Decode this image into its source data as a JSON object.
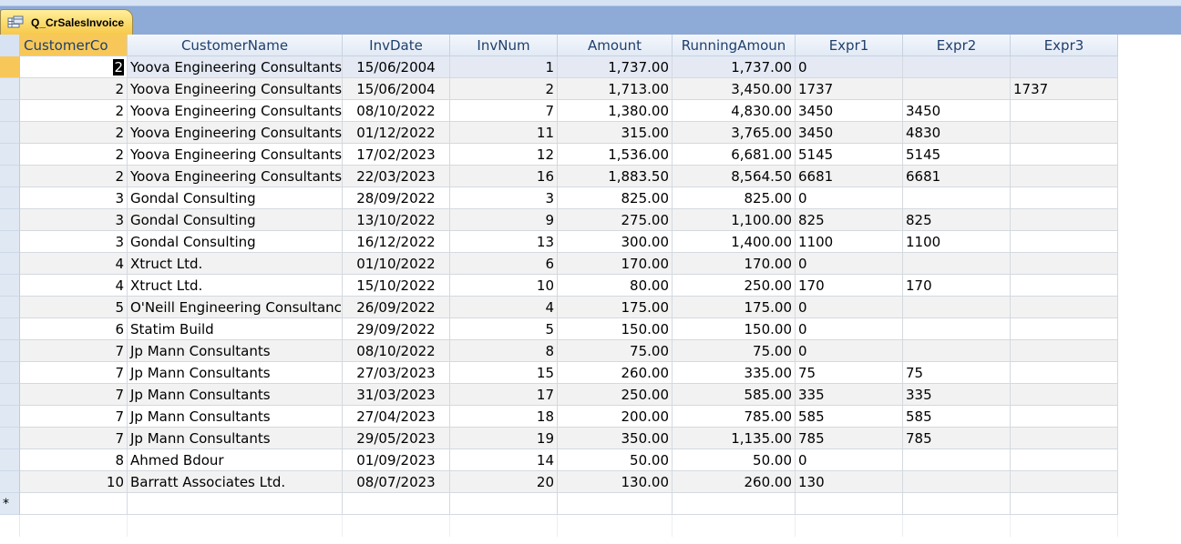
{
  "tab": {
    "title": "Q_CrSalesInvoice",
    "icon": "query-icon"
  },
  "columns": [
    "CustomerCo",
    "CustomerName",
    "InvDate",
    "InvNum",
    "Amount",
    "RunningAmoun",
    "Expr1",
    "Expr2",
    "Expr3"
  ],
  "rows": [
    [
      "2",
      "Yoova Engineering Consultants",
      "15/06/2004",
      "1",
      "1,737.00",
      "1,737.00",
      "0",
      "",
      ""
    ],
    [
      "2",
      "Yoova Engineering Consultants",
      "15/06/2004",
      "2",
      "1,713.00",
      "3,450.00",
      "1737",
      "",
      "1737"
    ],
    [
      "2",
      "Yoova Engineering Consultants",
      "08/10/2022",
      "7",
      "1,380.00",
      "4,830.00",
      "3450",
      "3450",
      ""
    ],
    [
      "2",
      "Yoova Engineering Consultants",
      "01/12/2022",
      "11",
      "315.00",
      "3,765.00",
      "3450",
      "4830",
      ""
    ],
    [
      "2",
      "Yoova Engineering Consultants",
      "17/02/2023",
      "12",
      "1,536.00",
      "6,681.00",
      "5145",
      "5145",
      ""
    ],
    [
      "2",
      "Yoova Engineering Consultants",
      "22/03/2023",
      "16",
      "1,883.50",
      "8,564.50",
      "6681",
      "6681",
      ""
    ],
    [
      "3",
      "Gondal Consulting",
      "28/09/2022",
      "3",
      "825.00",
      "825.00",
      "0",
      "",
      ""
    ],
    [
      "3",
      "Gondal Consulting",
      "13/10/2022",
      "9",
      "275.00",
      "1,100.00",
      "825",
      "825",
      ""
    ],
    [
      "3",
      "Gondal Consulting",
      "16/12/2022",
      "13",
      "300.00",
      "1,400.00",
      "1100",
      "1100",
      ""
    ],
    [
      "4",
      "Xtruct Ltd.",
      "01/10/2022",
      "6",
      "170.00",
      "170.00",
      "0",
      "",
      ""
    ],
    [
      "4",
      "Xtruct Ltd.",
      "15/10/2022",
      "10",
      "80.00",
      "250.00",
      "170",
      "170",
      ""
    ],
    [
      "5",
      "O'Neill Engineering Consultancy",
      "26/09/2022",
      "4",
      "175.00",
      "175.00",
      "0",
      "",
      ""
    ],
    [
      "6",
      "Statim Build",
      "29/09/2022",
      "5",
      "150.00",
      "150.00",
      "0",
      "",
      ""
    ],
    [
      "7",
      "Jp Mann Consultants",
      "08/10/2022",
      "8",
      "75.00",
      "75.00",
      "0",
      "",
      ""
    ],
    [
      "7",
      "Jp Mann Consultants",
      "27/03/2023",
      "15",
      "260.00",
      "335.00",
      "75",
      "75",
      ""
    ],
    [
      "7",
      "Jp Mann Consultants",
      "31/03/2023",
      "17",
      "250.00",
      "585.00",
      "335",
      "335",
      ""
    ],
    [
      "7",
      "Jp Mann Consultants",
      "27/04/2023",
      "18",
      "200.00",
      "785.00",
      "585",
      "585",
      ""
    ],
    [
      "7",
      "Jp Mann Consultants",
      "29/05/2023",
      "19",
      "350.00",
      "1,135.00",
      "785",
      "785",
      ""
    ],
    [
      "8",
      "Ahmed Bdour",
      "01/09/2023",
      "14",
      "50.00",
      "50.00",
      "0",
      "",
      ""
    ],
    [
      "10",
      "Barratt Associates Ltd.",
      "08/07/2023",
      "20",
      "130.00",
      "260.00",
      "130",
      "",
      ""
    ]
  ],
  "new_row_marker": "*"
}
